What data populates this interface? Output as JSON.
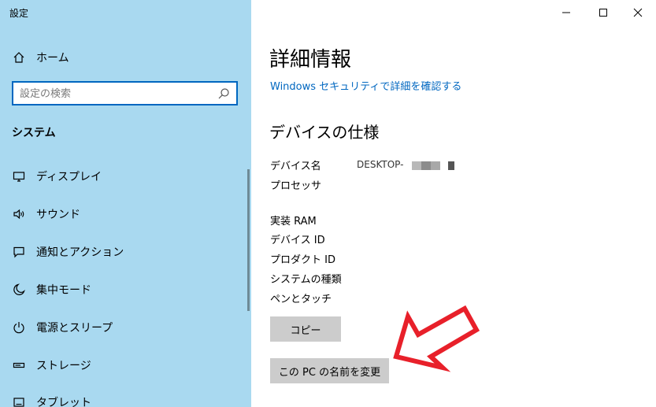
{
  "app": {
    "title": "設定"
  },
  "window_controls": {
    "minimize": "—",
    "maximize": "☐",
    "close": "✕"
  },
  "sidebar": {
    "home_label": "ホーム",
    "search_placeholder": "設定の検索",
    "section": "システム",
    "items": [
      {
        "label": "ディスプレイ",
        "icon": "display-icon"
      },
      {
        "label": "サウンド",
        "icon": "sound-icon"
      },
      {
        "label": "通知とアクション",
        "icon": "notification-icon"
      },
      {
        "label": "集中モード",
        "icon": "moon-icon"
      },
      {
        "label": "電源とスリープ",
        "icon": "power-icon"
      },
      {
        "label": "ストレージ",
        "icon": "storage-icon"
      },
      {
        "label": "タブレット",
        "icon": "tablet-icon"
      }
    ]
  },
  "main": {
    "title": "詳細情報",
    "security_link": "Windows セキュリティで詳細を確認する",
    "specs_title": "デバイスの仕様",
    "specs": [
      {
        "label": "デバイス名",
        "value": "DESKTOP-"
      },
      {
        "label": "プロセッサ",
        "value": ""
      },
      {
        "label": "実装 RAM",
        "value": ""
      },
      {
        "label": "デバイス ID",
        "value": ""
      },
      {
        "label": "プロダクト ID",
        "value": ""
      },
      {
        "label": "システムの種類",
        "value": ""
      },
      {
        "label": "ペンとタッチ",
        "value": ""
      }
    ],
    "copy_button": "コピー",
    "rename_button": "この PC の名前を変更"
  },
  "colors": {
    "sidebar_bg": "#a9d9f0",
    "accent": "#0067c0",
    "button_bg": "#cccccc",
    "annotation_arrow": "#e8202a"
  }
}
